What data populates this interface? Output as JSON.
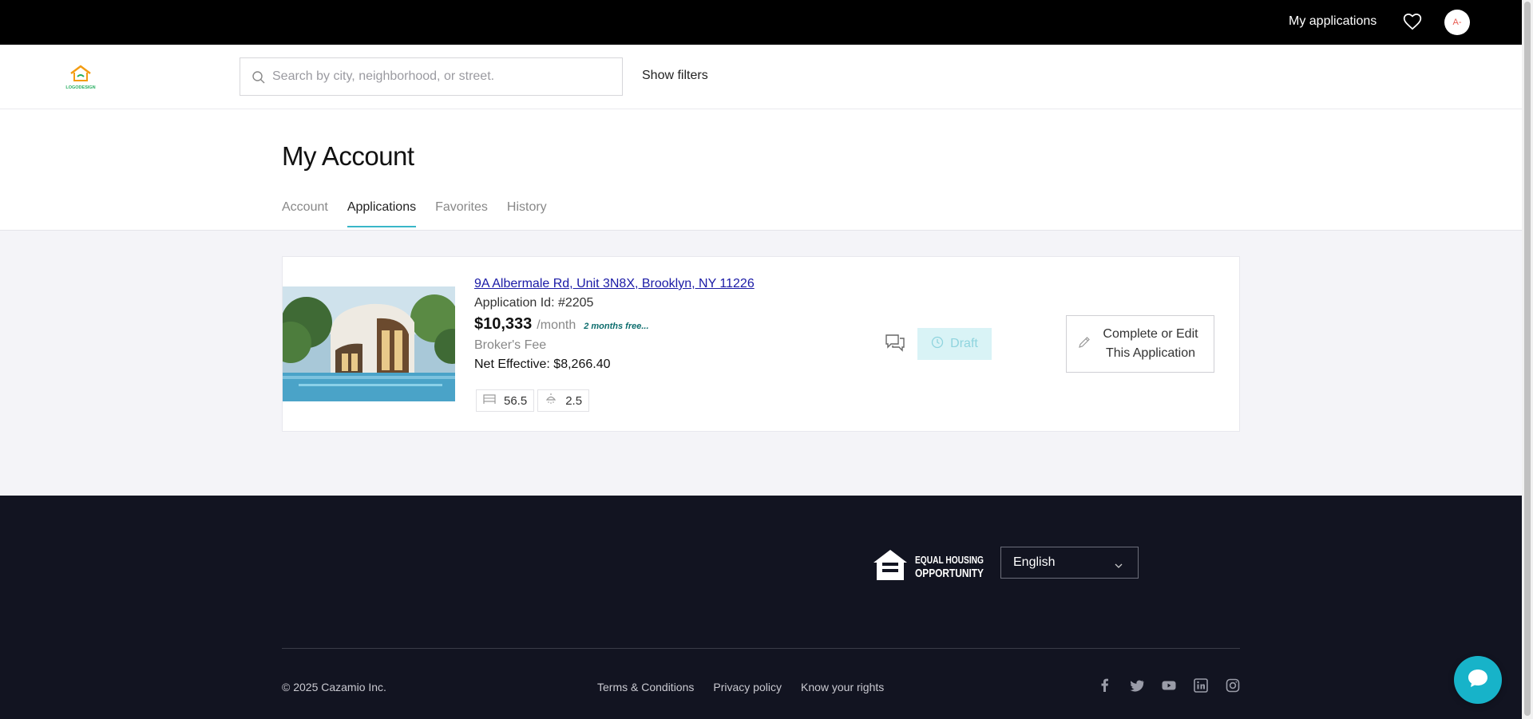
{
  "topbar": {
    "my_applications": "My applications",
    "avatar_initials": "A-"
  },
  "header": {
    "logo_text": "LOGODESIGN",
    "search_placeholder": "Search by city, neighborhood, or street.",
    "show_filters": "Show filters"
  },
  "page": {
    "title": "My Account",
    "tabs": [
      {
        "label": "Account",
        "active": false
      },
      {
        "label": "Applications",
        "active": true
      },
      {
        "label": "Favorites",
        "active": false
      },
      {
        "label": "History",
        "active": false
      }
    ]
  },
  "application": {
    "address": "9A Albermale Rd, Unit 3N8X, Brooklyn, NY 11226",
    "application_id": "Application Id: #2205",
    "price": "$10,333",
    "per_month": "/month",
    "promo": "2 months free...",
    "broker_fee": "Broker's Fee",
    "net_effective": "Net Effective: $8,266.40",
    "beds": "56.5",
    "baths": "2.5",
    "status": "Draft",
    "action_label": "Complete or Edit This Application"
  },
  "footer": {
    "eho_line1": "EQUAL HOUSING",
    "eho_line2": "OPPORTUNITY",
    "language": "English",
    "copyright": "© 2025 Cazamio Inc.",
    "links": [
      "Terms & Conditions",
      "Privacy policy",
      "Know your rights"
    ]
  },
  "colors": {
    "accent": "#38b6c8",
    "footer_bg": "#121421",
    "content_bg": "#f4f4f8"
  }
}
